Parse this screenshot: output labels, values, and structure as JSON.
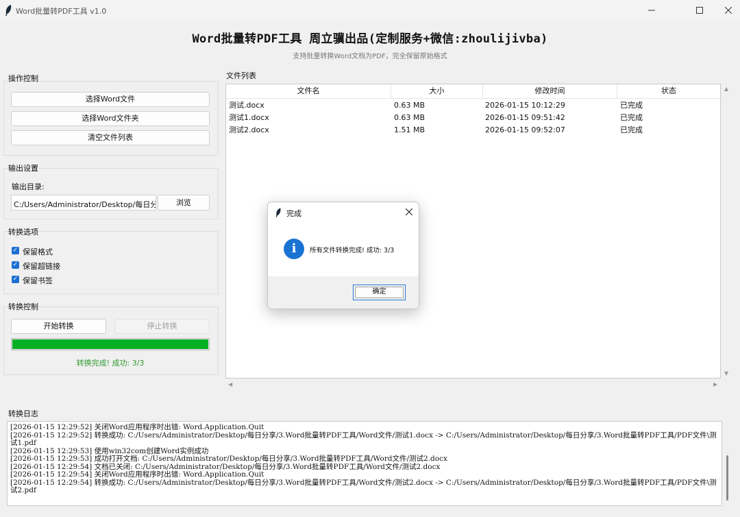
{
  "window": {
    "title": "Word批量转PDF工具 v1.0",
    "minimize_icon": "minimize-icon",
    "maximize_icon": "maximize-icon",
    "close_icon": "close-icon"
  },
  "header": {
    "title": "Word批量转PDF工具 周立骥出品(定制服务+微信:zhoulijivba)",
    "subtitle": "支持批量转换Word文档为PDF，完全保留原始格式"
  },
  "operation": {
    "label": "操作控制",
    "select_files": "选择Word文件",
    "select_folder": "选择Word文件夹",
    "clear_list": "清空文件列表"
  },
  "output": {
    "label": "输出设置",
    "dir_label": "输出目录:",
    "dir_value": "C:/Users/Administrator/Desktop/每日分享",
    "browse": "浏览"
  },
  "options": {
    "label": "转换选项",
    "items": [
      {
        "label": "保留格式",
        "checked": true
      },
      {
        "label": "保留超链接",
        "checked": true
      },
      {
        "label": "保留书签",
        "checked": true
      }
    ]
  },
  "control": {
    "label": "转换控制",
    "start": "开始转换",
    "stop": "停止转换",
    "progress": 1.0,
    "status": "转换完成! 成功: 3/3",
    "status_color": "#2e9a2e",
    "progress_color": "#06b025"
  },
  "file_list": {
    "label": "文件列表",
    "columns": [
      "文件名",
      "大小",
      "修改时间",
      "状态"
    ],
    "rows": [
      {
        "name": "测试.docx",
        "size": "0.63 MB",
        "mtime": "2026-01-15 10:12:29",
        "status": "已完成"
      },
      {
        "name": "测试1.docx",
        "size": "0.63 MB",
        "mtime": "2026-01-15 09:51:42",
        "status": "已完成"
      },
      {
        "name": "测试2.docx",
        "size": "1.51 MB",
        "mtime": "2026-01-15 09:52:07",
        "status": "已完成"
      }
    ]
  },
  "log": {
    "label": "转换日志",
    "lines": [
      "[2026-01-15 12:29:52] 关闭Word应用程序时出错: Word.Application.Quit",
      "[2026-01-15 12:29:52] 转换成功: C:/Users/Administrator/Desktop/每日分享/3.Word批量转PDF工具/Word文件/测试1.docx -> C:/Users/Administrator/Desktop/每日分享/3.Word批量转PDF工具/PDF文件\\测试1.pdf",
      "[2026-01-15 12:29:53] 使用win32com创建Word实例成功",
      "[2026-01-15 12:29:53] 成功打开文档: C:/Users/Administrator/Desktop/每日分享/3.Word批量转PDF工具/Word文件/测试2.docx",
      "[2026-01-15 12:29:54] 文档已关闭: C:/Users/Administrator/Desktop/每日分享/3.Word批量转PDF工具/Word文件/测试2.docx",
      "[2026-01-15 12:29:54] 关闭Word应用程序时出错: Word.Application.Quit",
      "[2026-01-15 12:29:54] 转换成功: C:/Users/Administrator/Desktop/每日分享/3.Word批量转PDF工具/Word文件/测试2.docx -> C:/Users/Administrator/Desktop/每日分享/3.Word批量转PDF工具/PDF文件\\测试2.pdf"
    ]
  },
  "dialog": {
    "title": "完成",
    "message": "所有文件转换完成! 成功: 3/3",
    "ok": "确定",
    "icon": "info-icon",
    "icon_char": "i"
  }
}
